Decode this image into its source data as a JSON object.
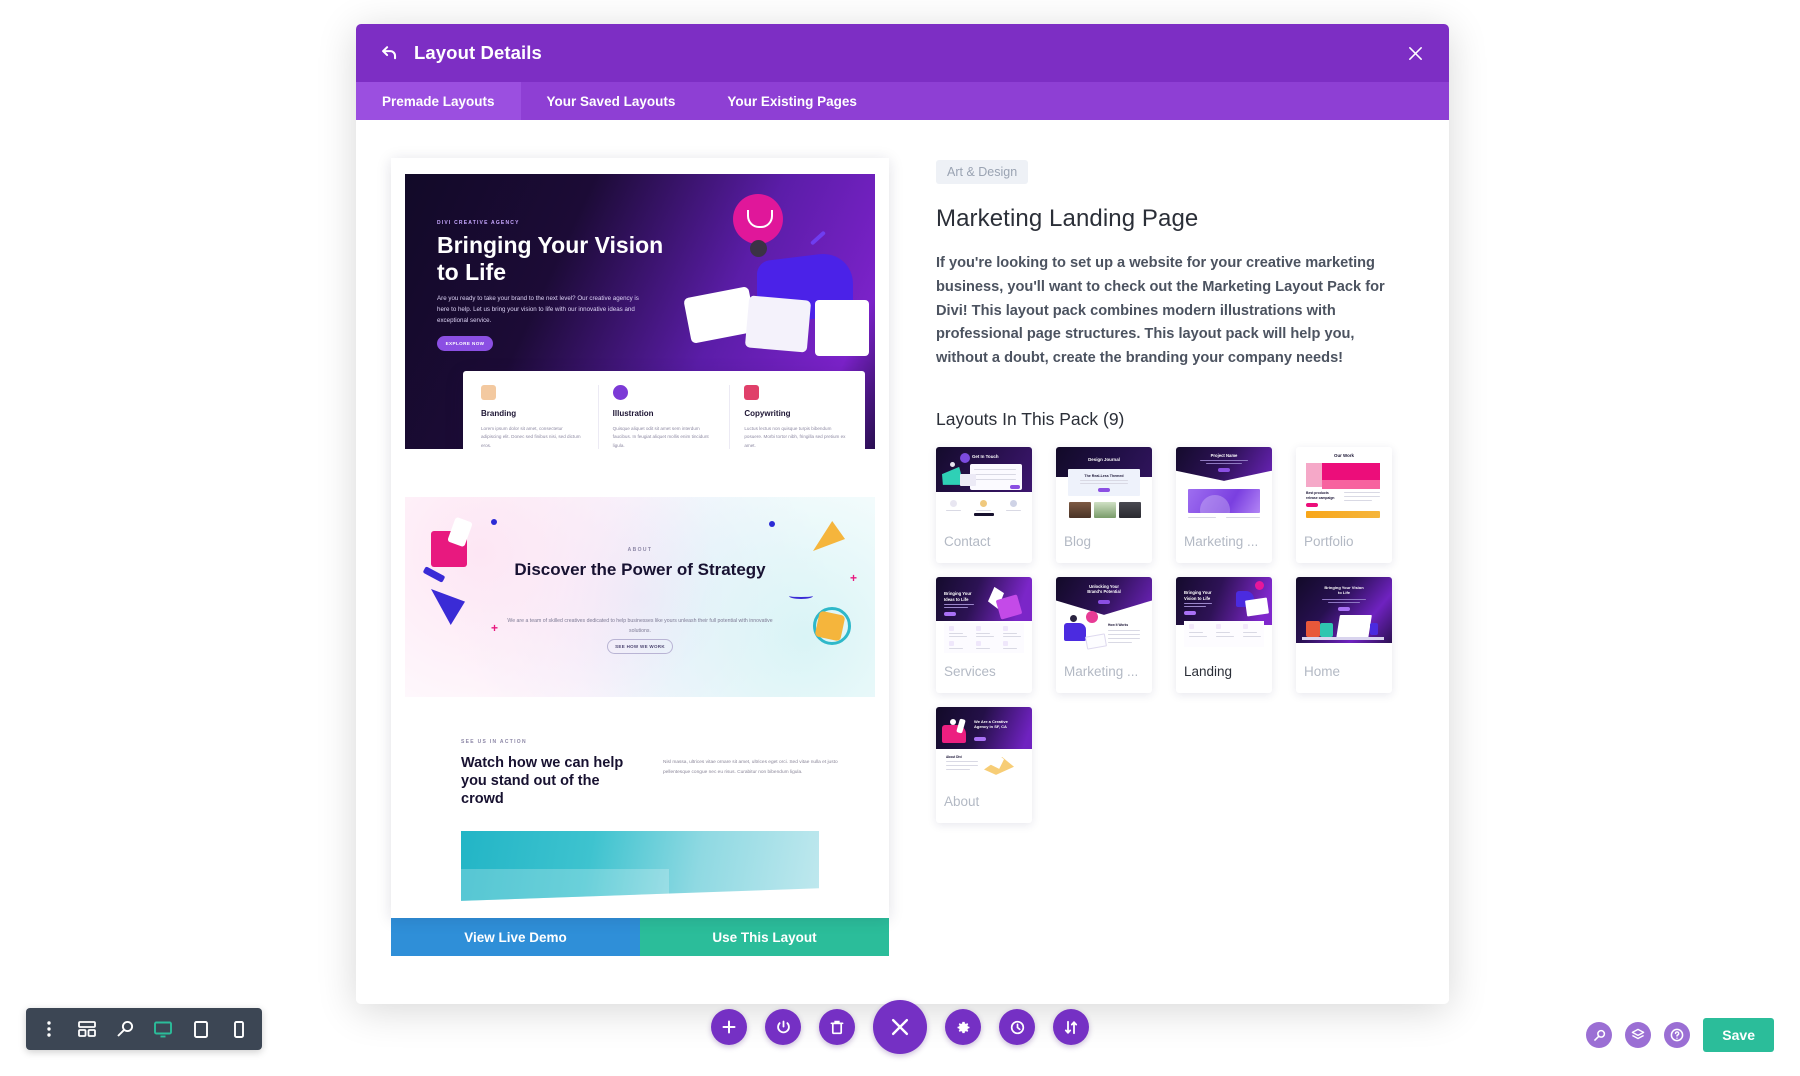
{
  "modal": {
    "title": "Layout Details",
    "back_icon": "back-arrow-icon",
    "close_icon": "close-icon",
    "tabs": [
      {
        "label": "Premade Layouts",
        "active": true
      },
      {
        "label": "Your Saved Layouts",
        "active": false
      },
      {
        "label": "Your Existing Pages",
        "active": false
      }
    ]
  },
  "preview": {
    "hero": {
      "eyebrow": "DIVI CREATIVE AGENCY",
      "title": "Bringing Your Vision to Life",
      "paragraph": "Are you ready to take your brand to the next level? Our creative agency is here to help. Let us bring your vision to life with our innovative ideas and exceptional service.",
      "cta": "EXPLORE NOW",
      "features": [
        {
          "title": "Branding",
          "desc": "Lorem ipsum dolor sit amet, consectetur adipiscing elit. Donec sed finibus nisi, sed dictum eros."
        },
        {
          "title": "Illustration",
          "desc": "Quisque aliquet odit sit amet sem interdum faucibus. In feugiat aliquet mollis enim tincidunt ligula."
        },
        {
          "title": "Copywriting",
          "desc": "Luctus lectus non quisque turpis bibendum posuere. Morbi tortor nibh, fringilla sed pretium ex amet."
        }
      ]
    },
    "section2": {
      "eyebrow": "ABOUT",
      "title": "Discover the Power of Strategy",
      "paragraph": "We are a team of skilled creatives dedicated to help businesses like yours unleash their full potential with innovative solutions.",
      "button": "SEE HOW WE WORK"
    },
    "section3": {
      "eyebrow": "SEE US IN ACTION",
      "title": "Watch how we can help you stand out of the crowd",
      "body": "Nisl massa, ultrices vitae ornare sit amet, ultrices eget orci. Sed vitae nulla et justo pellentesque congue nec eu risus. Curabitur non bibendum ligula."
    },
    "actions": {
      "view_demo": "View Live Demo",
      "use_layout": "Use This Layout"
    }
  },
  "details": {
    "category": "Art & Design",
    "title": "Marketing Landing Page",
    "description": "If you're looking to set up a website for your creative marketing business, you'll want to check out the Marketing Layout Pack for Divi! This layout pack combines modern illustrations with professional page structures. This layout pack will help you, without a doubt, create the branding your company needs!",
    "layouts_heading": "Layouts In This Pack (9)",
    "layouts": [
      {
        "name": "Contact",
        "thumb_title": "Get In Touch",
        "selected": false
      },
      {
        "name": "Blog",
        "thumb_title": "Design Journal",
        "selected": false
      },
      {
        "name": "Marketing ...",
        "thumb_title": "Project Name",
        "selected": false
      },
      {
        "name": "Portfolio",
        "thumb_title": "Our Work",
        "selected": false
      },
      {
        "name": "Services",
        "thumb_title": "Bringing Your Ideas to Life",
        "selected": false
      },
      {
        "name": "Marketing ...",
        "thumb_title": "Unlocking Your Brand's Potential",
        "selected": false
      },
      {
        "name": "Landing",
        "thumb_title": "Bringing Your Vision to Life",
        "selected": true
      },
      {
        "name": "Home",
        "thumb_title": "Bringing Your Vision to Life",
        "selected": false
      },
      {
        "name": "About",
        "thumb_title": "We Are a Creative Agency in SF, CA",
        "selected": false
      }
    ]
  },
  "view_toolbar": {
    "items": [
      {
        "icon": "dots-vertical-icon",
        "active": false
      },
      {
        "icon": "wireframe-icon",
        "active": false
      },
      {
        "icon": "zoom-out-icon",
        "active": false
      },
      {
        "icon": "desktop-icon",
        "active": true
      },
      {
        "icon": "tablet-icon",
        "active": false
      },
      {
        "icon": "phone-icon",
        "active": false
      }
    ]
  },
  "center_toolbar": {
    "items": [
      {
        "icon": "plus-icon",
        "main": false
      },
      {
        "icon": "power-icon",
        "main": false
      },
      {
        "icon": "trash-icon",
        "main": false
      },
      {
        "icon": "close-x-icon",
        "main": true
      },
      {
        "icon": "gear-icon",
        "main": false
      },
      {
        "icon": "history-icon",
        "main": false
      },
      {
        "icon": "sort-icon",
        "main": false
      }
    ]
  },
  "bottom_right": {
    "icons": [
      {
        "icon": "search-icon"
      },
      {
        "icon": "layers-icon"
      },
      {
        "icon": "help-icon"
      }
    ],
    "save_label": "Save"
  },
  "colors": {
    "brand_purple": "#7d2ec4",
    "tab_purple": "#9b4fe0",
    "teal": "#2bbd9a",
    "blue": "#2f8fd8",
    "toolbar_dark": "#3c4654"
  }
}
